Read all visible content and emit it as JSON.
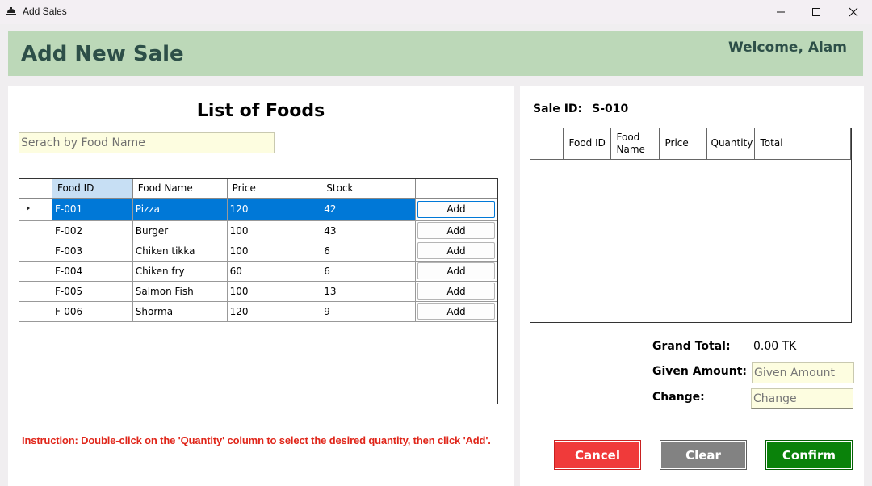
{
  "window": {
    "title": "Add Sales"
  },
  "header": {
    "title": "Add New Sale",
    "welcome": "Welcome, Alam"
  },
  "foods": {
    "title": "List of Foods",
    "search_placeholder": "Serach by Food Name",
    "columns": [
      "Food ID",
      "Food Name",
      "Price",
      "Stock"
    ],
    "add_label": "Add",
    "rows": [
      {
        "id": "F-001",
        "name": "Pizza",
        "price": "120",
        "stock": "42"
      },
      {
        "id": "F-002",
        "name": "Burger",
        "price": "100",
        "stock": "43"
      },
      {
        "id": "F-003",
        "name": "Chiken tikka",
        "price": "100",
        "stock": "6"
      },
      {
        "id": "F-004",
        "name": "Chiken fry",
        "price": "60",
        "stock": "6"
      },
      {
        "id": "F-005",
        "name": "Salmon Fish",
        "price": "100",
        "stock": "13"
      },
      {
        "id": "F-006",
        "name": "Shorma",
        "price": "120",
        "stock": "9"
      }
    ]
  },
  "instruction": "Instruction: Double-click on the 'Quantity' column to select the desired quantity, then click 'Add'.",
  "sale": {
    "id_label": "Sale ID:",
    "id_value": "S-010",
    "columns": [
      "Food ID",
      "Food Name",
      "Price",
      "Quantity",
      "Total"
    ]
  },
  "totals": {
    "grand_total_label": "Grand Total:",
    "grand_total_value": "0.00 TK",
    "given_amount_label": "Given Amount:",
    "given_amount_placeholder": "Given Amount",
    "change_label": "Change:",
    "change_placeholder": "Change"
  },
  "actions": {
    "cancel": "Cancel",
    "clear": "Clear",
    "confirm": "Confirm"
  },
  "colors": {
    "header_bg": "#bcd8b8",
    "header_text": "#2d4f48",
    "selection": "#0078d7",
    "instruction": "#e0261a",
    "cancel": "#f03a3a",
    "clear": "#828282",
    "confirm": "#0a820a",
    "input_bg": "#fdfde0"
  }
}
